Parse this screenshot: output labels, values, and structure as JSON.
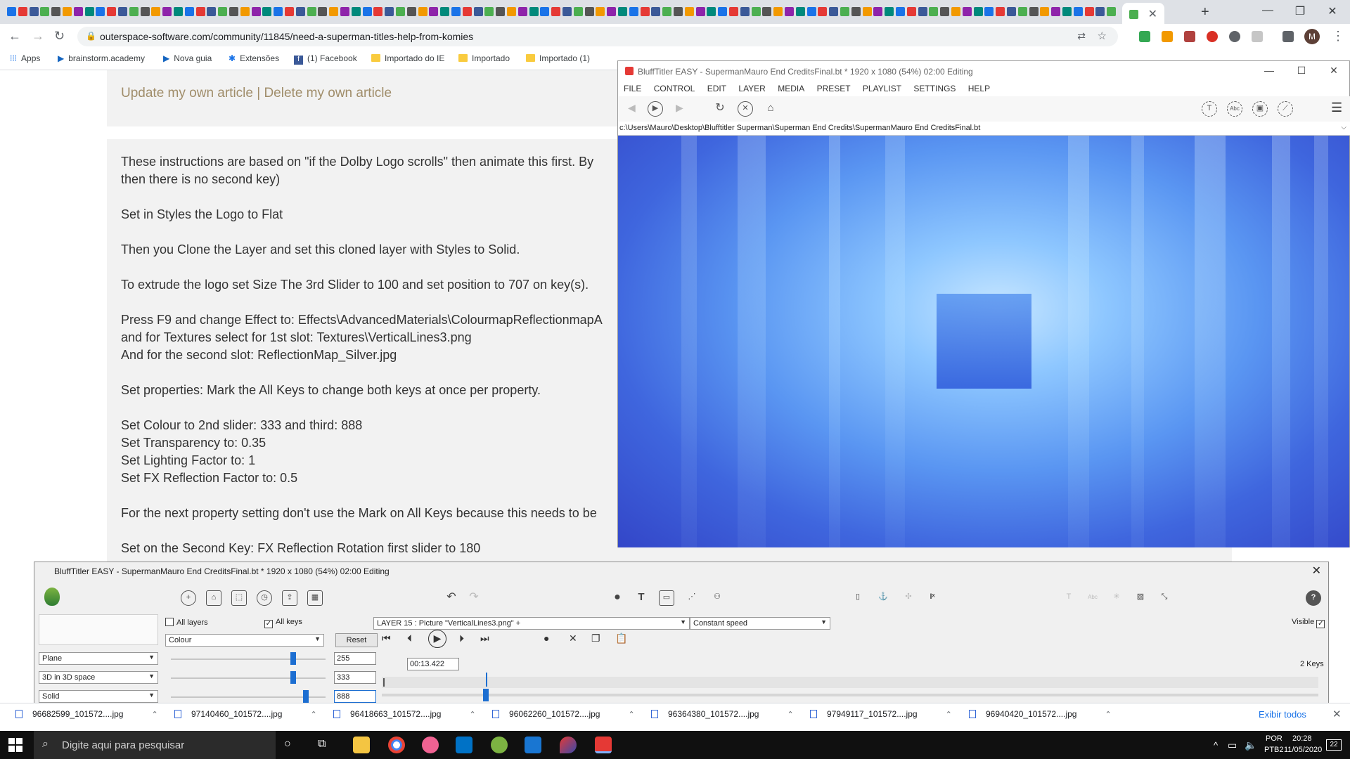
{
  "browser": {
    "active_tab_close": "✕",
    "new_tab": "+",
    "window_controls": [
      "—",
      "❐",
      "✕"
    ],
    "url": "outerspace-software.com/community/11845/need-a-superman-titles-help-from-komies",
    "profile_initial": "M",
    "bookmarks": [
      {
        "label": "Apps",
        "kind": "apps"
      },
      {
        "label": "brainstorm.academy",
        "kind": "link"
      },
      {
        "label": "Nova guia",
        "kind": "link"
      },
      {
        "label": "Extensões",
        "kind": "link"
      },
      {
        "label": "(1) Facebook",
        "kind": "link"
      },
      {
        "label": "Importado do IE",
        "kind": "folder"
      },
      {
        "label": "Importado",
        "kind": "folder"
      },
      {
        "label": "Importado (1)",
        "kind": "folder"
      }
    ]
  },
  "article": {
    "edit_links": "Update my own article | Delete my own article",
    "paragraphs": [
      "These instructions are based on \"if the Dolby Logo scrolls\" then animate this first. By",
      "then there is no second key)",
      "Set in Styles the Logo to Flat",
      "Then you Clone the Layer and set this cloned layer with Styles to Solid.",
      "To extrude the logo set Size The 3rd Slider to 100 and set position to 707 on key(s).",
      "Press F9 and change Effect to: Effects\\AdvancedMaterials\\ColourmapReflectionmapA",
      "and for Textures select for 1st slot: Textures\\VerticalLines3.png",
      "And for the second slot: ReflectionMap_Silver.jpg",
      "Set properties: Mark the All Keys to change both keys at once per property.",
      "Set Colour to 2nd slider: 333 and third: 888",
      "Set Transparency to: 0.35",
      "Set Lighting Factor to: 1",
      "Set FX Reflection Factor to: 0.5",
      "For the next property setting don't use the Mark on All Keys because this needs to be",
      "Set on the Second Key: FX Reflection Rotation first slider to 180"
    ]
  },
  "preview_window": {
    "title": "BluffTitler EASY  - SupermanMauro End CreditsFinal.bt * 1920 x 1080 (54%) 02:00 Editing",
    "menu": [
      "FILE",
      "CONTROL",
      "EDIT",
      "LAYER",
      "MEDIA",
      "PRESET",
      "PLAYLIST",
      "SETTINGS",
      "HELP"
    ],
    "path": "c:\\Users\\Mauro\\Desktop\\Blufftitler Superman\\Superman End Credits\\SupermanMauro End CreditsFinal.bt"
  },
  "panel": {
    "title": "BluffTitler EASY  - SupermanMauro End CreditsFinal.bt * 1920 x 1080 (54%) 02:00 Editing",
    "all_layers_label": "All layers",
    "all_layers_checked": false,
    "all_keys_label": "All keys",
    "all_keys_checked": true,
    "property_select": "Colour",
    "reset_label": "Reset",
    "layer_select": "LAYER 15    : Picture \"VerticalLines3.png\" +",
    "speed_select": "Constant speed",
    "visible_label": "Visible",
    "visible_checked": true,
    "keys_count": "2 Keys",
    "time_value": "00:13.422",
    "rows": [
      {
        "select": "Plane",
        "value": "255"
      },
      {
        "select": "3D in 3D space",
        "value": "333"
      },
      {
        "select": "Solid",
        "value": "888"
      }
    ],
    "slider_max": 1000
  },
  "downloads": {
    "files": [
      "96682599_101572....jpg",
      "97140460_101572....jpg",
      "96418663_101572....jpg",
      "96062260_101572....jpg",
      "96364380_101572....jpg",
      "97949117_101572....jpg",
      "96940420_101572....jpg"
    ],
    "show_all": "Exibir todos"
  },
  "taskbar": {
    "search_placeholder": "Digite aqui para pesquisar",
    "lang": "POR",
    "layout": "PTB2",
    "time": "20:28",
    "date": "11/05/2020",
    "notifications": "22"
  }
}
